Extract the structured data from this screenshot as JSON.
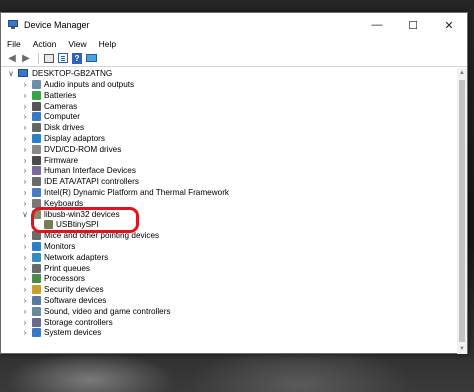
{
  "window": {
    "title": "Device Manager"
  },
  "controls": {
    "minimize": "—",
    "maximize": "☐",
    "close": "✕"
  },
  "menu": [
    "File",
    "Action",
    "View",
    "Help"
  ],
  "root": {
    "label": "DESKTOP-GB2ATNG"
  },
  "categories": [
    {
      "label": "Audio inputs and outputs",
      "icon_color": "#6f8fa8"
    },
    {
      "label": "Batteries",
      "icon_color": "#3aa34a"
    },
    {
      "label": "Cameras",
      "icon_color": "#555555"
    },
    {
      "label": "Computer",
      "icon_color": "#3b78c4"
    },
    {
      "label": "Disk drives",
      "icon_color": "#666666"
    },
    {
      "label": "Display adaptors",
      "icon_color": "#2f7fc8"
    },
    {
      "label": "DVD/CD-ROM drives",
      "icon_color": "#888888"
    },
    {
      "label": "Firmware",
      "icon_color": "#4a4a4a"
    },
    {
      "label": "Human Interface Devices",
      "icon_color": "#7a6a9a"
    },
    {
      "label": "IDE ATA/ATAPI controllers",
      "icon_color": "#6a6a6a"
    },
    {
      "label": "Intel(R) Dynamic Platform and Thermal Framework",
      "icon_color": "#4a7ac0"
    },
    {
      "label": "Keyboards",
      "icon_color": "#777777"
    },
    {
      "label": "libusb-win32 devices",
      "icon_color": "#8a8a6a",
      "expanded": true
    },
    {
      "label": "USBtinySPI",
      "icon_color": "#7a7a5a",
      "child": true
    },
    {
      "label": "Mice and other pointing devices",
      "icon_color": "#6a6a6a"
    },
    {
      "label": "Monitors",
      "icon_color": "#2f7fc8"
    },
    {
      "label": "Network adapters",
      "icon_color": "#3a8ac0"
    },
    {
      "label": "Print queues",
      "icon_color": "#6a6a6a"
    },
    {
      "label": "Processors",
      "icon_color": "#4a8a4a"
    },
    {
      "label": "Security devices",
      "icon_color": "#c8a030"
    },
    {
      "label": "Software devices",
      "icon_color": "#5a7aa0"
    },
    {
      "label": "Sound, video and game controllers",
      "icon_color": "#6a8a9a"
    },
    {
      "label": "Storage controllers",
      "icon_color": "#6a6a8a"
    },
    {
      "label": "System devices",
      "icon_color": "#3b78c4"
    }
  ],
  "colors": {
    "highlight": "#e0141e"
  }
}
